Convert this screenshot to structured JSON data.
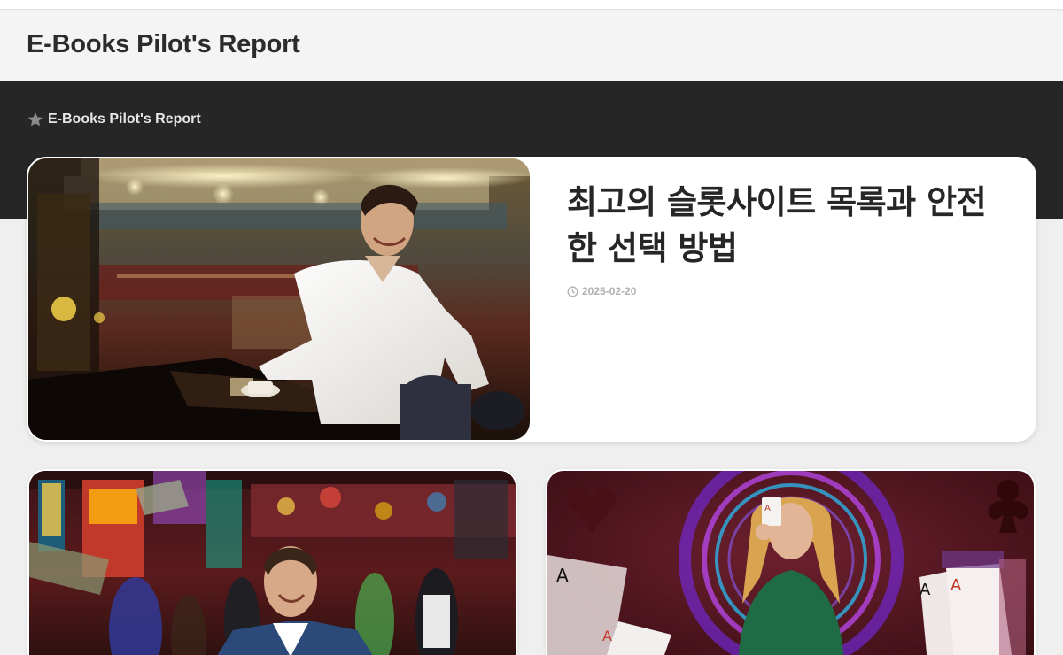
{
  "site": {
    "title": "E-Books Pilot's Report"
  },
  "breadcrumb": {
    "icon": "star-icon",
    "label": "E-Books Pilot's Report"
  },
  "featured": {
    "title": "최고의 슬롯사이트 목록과 안전한 선택 방법",
    "date": "2025-02-20",
    "date_icon": "clock-icon",
    "image": "man-smiling-at-casino-bar-photo"
  },
  "cards": [
    {
      "image": "man-smiling-in-casino-slots-photo"
    },
    {
      "image": "woman-holding-aces-cards-photo"
    }
  ],
  "colors": {
    "header_bg": "#f4f4f4",
    "band_bg": "#262626",
    "page_bg": "#efefef",
    "meta_gray": "#b0b0b0"
  }
}
